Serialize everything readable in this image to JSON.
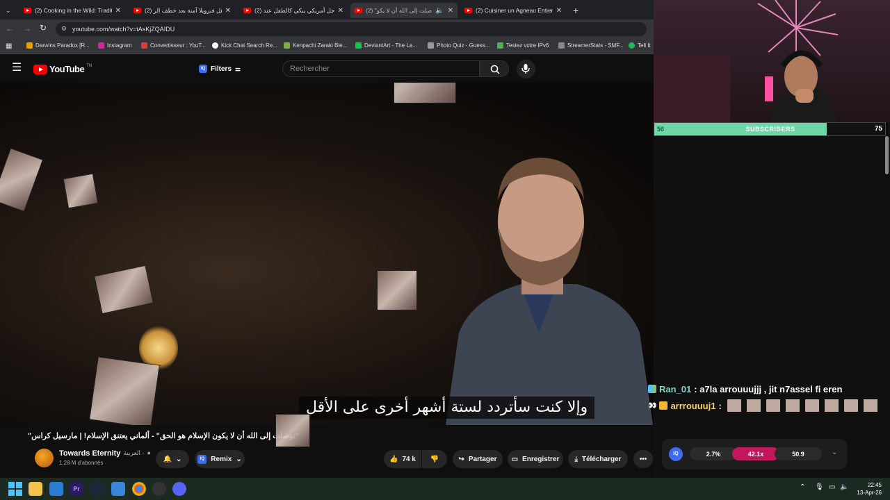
{
  "browser": {
    "tabs": [
      {
        "title": "(2) Cooking in the Wild: Traditio"
      },
      {
        "title": "(2) هل فنزويلا آمنة بعد خطف الر"
      },
      {
        "title": "(2) رجل أمريكي يبكي كالطفل عند"
      },
      {
        "title": "(2) \"توصلت إلى الله أن لا يكو"
      },
      {
        "title": "(2) Cuisiner un Agneau Entier s"
      }
    ],
    "url": "youtube.com/watch?v=tAsKjZQAIDU",
    "bookmarks": [
      {
        "label": "Darwins Paradox [R...",
        "color": "#e5a000"
      },
      {
        "label": "Instagram",
        "color": "#d6249f"
      },
      {
        "label": "Convertisseur : YouT...",
        "color": "#e53935"
      },
      {
        "label": "Kick Chat Search Re...",
        "color": "#ffffff"
      },
      {
        "label": "Kenpachi Zaraki Ble...",
        "color": "#7cb342"
      },
      {
        "label": "DeviantArt - The La...",
        "color": "#05cc47"
      },
      {
        "label": "Photo Quiz - Guess...",
        "color": "#999999"
      },
      {
        "label": "Testez votre IPv6",
        "color": "#4caf50"
      },
      {
        "label": "StreamerStats - SMF...",
        "color": "#888888"
      },
      {
        "label": "Tell It",
        "color": "#1db954"
      }
    ]
  },
  "youtube": {
    "logo": "YouTube",
    "logo_sup": "TN",
    "filters_label": "Filters",
    "search_placeholder": "Rechercher",
    "subtitle": "وإلا كنت سأتردد لستة أشهر أخرى على الأقل",
    "video_title": "\"توصلت إلى الله أن لا يكون الإسلام هو الحق\" - ألماني يعتنق الإسلام! | مارسيل كراس\"",
    "channel_name": "Towards Eternity",
    "channel_lang": "العربية -",
    "subscribers": "1,28 M d'abonnés",
    "remix_label": "Remix",
    "likes": "74 k",
    "share_label": "Partager",
    "save_label": "Enregistrer",
    "download_label": "Télécharger"
  },
  "overlay": {
    "sub_count": "56",
    "sub_label": "SUBSCRIBERS",
    "sub_goal": "75",
    "sub_progress": 0.747,
    "chat": [
      {
        "user": "Ran_01",
        "message": ": a7la arrouuujjj , jit n7assel fi eren",
        "color": "#7fd4c8"
      },
      {
        "user": "arrrouuuj1",
        "message": ":",
        "color": "#f2d26b"
      }
    ],
    "stats": {
      "a": "2.7%",
      "b": "42.1x",
      "c": "50.9"
    },
    "accent_pink": "#c2185b"
  },
  "taskbar": {
    "time": "22:45",
    "date": "13-Apr-26"
  }
}
